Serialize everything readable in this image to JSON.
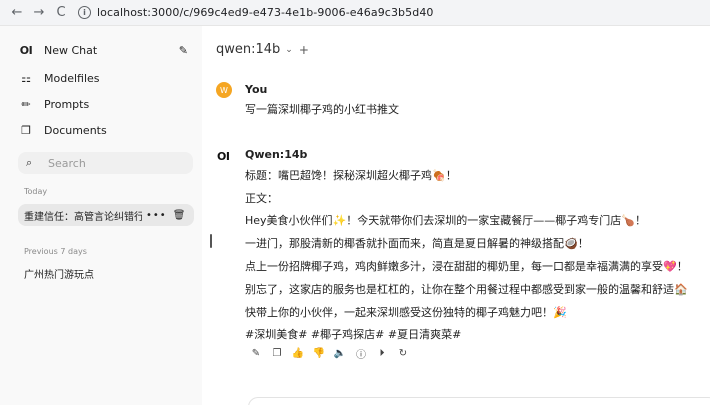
{
  "browser": {
    "url": "localhost:3000/c/969c4ed9-e473-4e1b-9006-e46a9c3b5d40",
    "back_icon": "←",
    "forward_icon": "→",
    "reload_icon": "C"
  },
  "sidebar": {
    "logo": "OI",
    "new_chat": "New Chat",
    "items": [
      {
        "label": "Modelfiles",
        "icon": "modelfiles-icon"
      },
      {
        "label": "Prompts",
        "icon": "pencil-icon"
      },
      {
        "label": "Documents",
        "icon": "documents-icon"
      }
    ],
    "search_placeholder": "Search",
    "today_label": "Today",
    "today_chats": [
      {
        "title": "重建信任：高管言论纠错行动"
      }
    ],
    "prev_label": "Previous 7 days",
    "prev_chats": [
      {
        "title": "广州热门游玩点"
      }
    ]
  },
  "main": {
    "model_name": "qwen:14b",
    "user": {
      "avatar_letter": "W",
      "name": "You",
      "text": "写一篇深圳椰子鸡的小红书推文"
    },
    "assistant": {
      "avatar": "OI",
      "name": "Qwen:14b",
      "lines": [
        "标题：嘴巴超馋！探秘深圳超火椰子鸡🍖！",
        "正文：",
        "Hey美食小伙伴们✨！今天就带你们去深圳的一家宝藏餐厅——椰子鸡专门店🍗！",
        "一进门，那股清新的椰香就扑面而来，简直是夏日解暑的神级搭配🥥！",
        "点上一份招牌椰子鸡，鸡肉鲜嫩多汁，浸在甜甜的椰奶里，每一口都是幸福满满的享受💖！",
        "别忘了，这家店的服务也是杠杠的，让你在整个用餐过程中都感受到家一般的温馨和舒适🏠",
        "快带上你的小伙伴，一起来深圳感受这份独特的椰子鸡魅力吧！🎉",
        "#深圳美食# #椰子鸡探店# #夏日清爽菜#"
      ]
    }
  },
  "colors": {
    "sidebar_bg": "#f9f9f9",
    "active_chat_bg": "#e8e8e8",
    "user_avatar": "#f5a623"
  }
}
